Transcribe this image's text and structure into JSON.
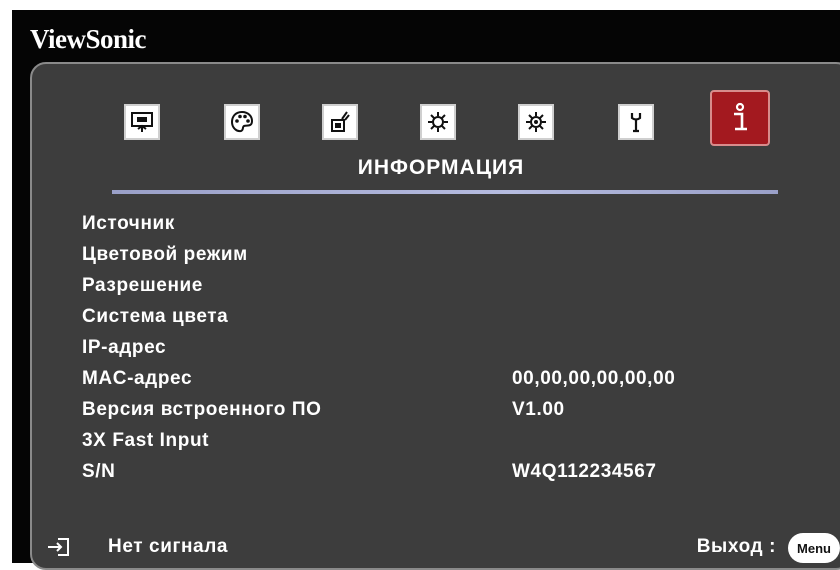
{
  "brand": "ViewSonic",
  "tabs": [
    {
      "icon": "display-icon",
      "active": false
    },
    {
      "icon": "palette-icon",
      "active": false
    },
    {
      "icon": "power-icon",
      "active": false
    },
    {
      "icon": "gear-icon",
      "active": false
    },
    {
      "icon": "advanced-gear-icon",
      "active": false
    },
    {
      "icon": "wrench-icon",
      "active": false
    },
    {
      "icon": "info-icon",
      "active": true
    }
  ],
  "section_title": "ИНФОРМАЦИЯ",
  "rows": [
    {
      "label": "Источник",
      "value": ""
    },
    {
      "label": "Цветовой режим",
      "value": ""
    },
    {
      "label": "Разрешение",
      "value": ""
    },
    {
      "label": "Система цвета",
      "value": ""
    },
    {
      "label": "IP-адрес",
      "value": ""
    },
    {
      "label": "MAC-адрес",
      "value": "00,00,00,00,00,00"
    },
    {
      "label": "Версия встроенного ПО",
      "value": "V1.00"
    },
    {
      "label": "3X Fast Input",
      "value": ""
    },
    {
      "label": "S/N",
      "value": "W4Q112234567"
    }
  ],
  "footer": {
    "status": "Нет сигнала",
    "exit_label": "Выход :",
    "menu_button": "Menu"
  },
  "colors": {
    "panel": "#3d3d3d",
    "active_tab": "#a3191f",
    "text": "#ffffff"
  }
}
